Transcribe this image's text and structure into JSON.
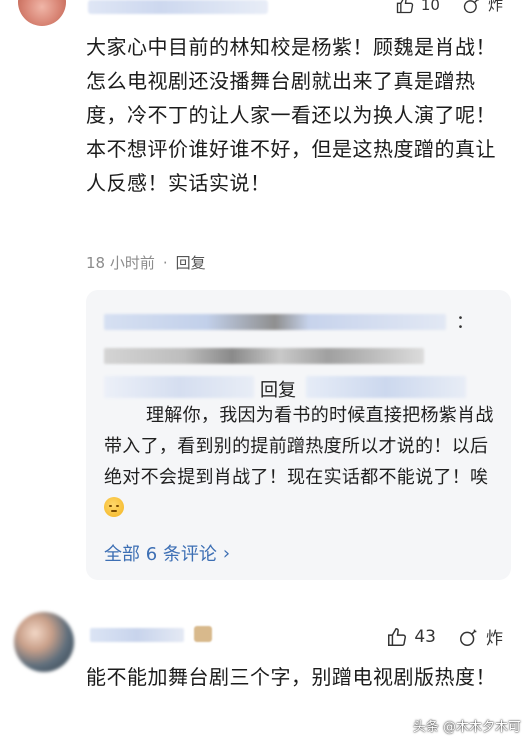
{
  "top": {
    "like_count": "10",
    "share_label": "炸"
  },
  "comment1": {
    "text": "大家心中目前的林知校是杨紫！顾魏是肖战！怎么电视剧还没播舞台剧就出来了真是蹭热度，冷不丁的让人家一看还以为换人演了呢！本不想评价谁好谁不好，但是这热度蹭的真让人反感！实话实说！",
    "time": "18 小时前",
    "separator": "·",
    "reply_label": "回复"
  },
  "reply_box": {
    "colon": "：",
    "reply_label": "回复",
    "text": "理解你，我因为看书的时候直接把杨紫肖战带入了，看到别的提前蹭热度所以才说的！以后绝对不会提到肖战了！现在实话都不能说了！唉",
    "view_all": "全部 6 条评论",
    "chevron": "›"
  },
  "comment2": {
    "like_count": "43",
    "share_label": "炸",
    "text": "能不能加舞台剧三个字，别蹭电视剧版热度！"
  },
  "watermark": {
    "text": "头条 @木木夕木可"
  },
  "colors": {
    "link": "#3d6fb4",
    "meta": "#8c8c8c",
    "reply_bg": "#f5f6f8"
  }
}
